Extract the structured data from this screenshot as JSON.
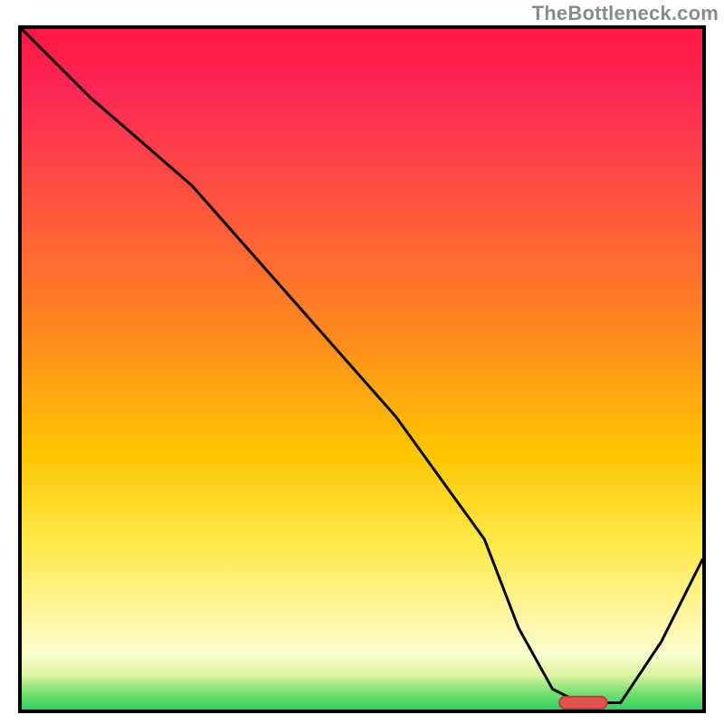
{
  "watermark": "TheBottleneck.com",
  "colors": {
    "gradient_top": "#ff1744",
    "gradient_mid": "#ffc400",
    "gradient_bottom": "#2ecf62",
    "frame_border": "#000000",
    "curve": "#000000",
    "marker_fill": "#e2524f",
    "marker_stroke": "#c33a35"
  },
  "chart_data": {
    "type": "line",
    "title": "",
    "xlabel": "",
    "ylabel": "",
    "xlim": [
      0,
      100
    ],
    "ylim": [
      0,
      100
    ],
    "series": [
      {
        "name": "bottleneck-curve",
        "x": [
          0,
          10,
          25,
          40,
          55,
          68,
          73,
          78,
          82,
          88,
          94,
          100
        ],
        "y": [
          100,
          90,
          77,
          60,
          43,
          25,
          12,
          3,
          1,
          1,
          10,
          22
        ]
      }
    ],
    "annotations": {
      "optimum_marker": {
        "x_start": 79,
        "x_end": 86,
        "y": 1
      }
    }
  }
}
